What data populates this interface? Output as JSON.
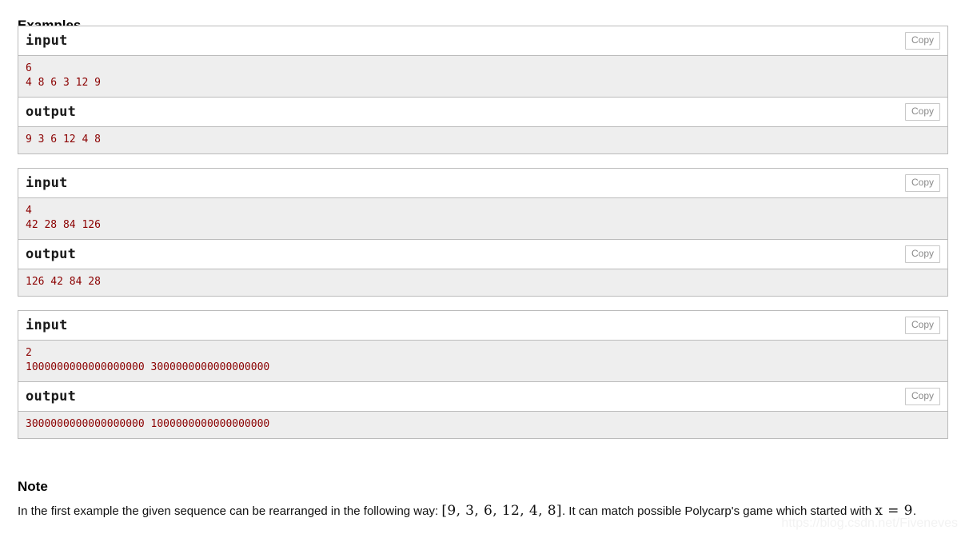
{
  "sections": {
    "examples_title": "Examples",
    "note_title": "Note"
  },
  "labels": {
    "input": "input",
    "output": "output",
    "copy": "Copy"
  },
  "colors": {
    "io_text": "#8b0000",
    "pre_background": "#eeeeee",
    "box_border": "#bbbbbb",
    "copy_border": "#c8c8c8",
    "copy_text": "#8a8a8a",
    "watermark": "#f2f2f2"
  },
  "sample_tests": [
    {
      "input_label": "input",
      "output_label": "output",
      "copy_input_label": "Copy",
      "copy_output_label": "Copy",
      "input_text": "6\n4 8 6 3 12 9",
      "output_text": "9 3 6 12 4 8"
    },
    {
      "input_label": "input",
      "output_label": "output",
      "copy_input_label": "Copy",
      "copy_output_label": "Copy",
      "input_text": "4\n42 28 84 126",
      "output_text": "126 42 84 28"
    },
    {
      "input_label": "input",
      "output_label": "output",
      "copy_input_label": "Copy",
      "copy_output_label": "Copy",
      "input_text": "2\n1000000000000000000 3000000000000000000",
      "output_text": "3000000000000000000 1000000000000000000"
    }
  ],
  "note": {
    "text_before_sequence": "In the first example the given sequence can be rearranged in the following way: ",
    "sequence": "[9, 3, 6, 12, 4, 8]",
    "text_after_sequence": ". It can match possible Polycarp's game which started with ",
    "math_variable": "x",
    "math_equals": " = ",
    "math_value": "9",
    "text_end": "."
  },
  "watermark": "https://blog.csdn.net/Fiveneves"
}
